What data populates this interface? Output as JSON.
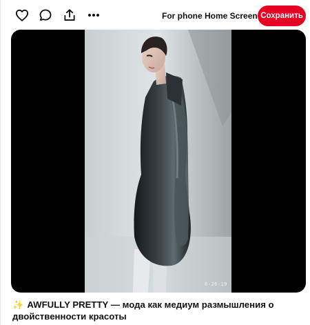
{
  "toolbar": {
    "icons": [
      "heart-icon",
      "comment-icon",
      "share-icon",
      "more-icon"
    ],
    "board_label": "For phone Home Screen",
    "save_label": "Сохранить",
    "save_color": "#e60023"
  },
  "media": {
    "stamp": "6-26-19"
  },
  "caption": {
    "emoji": "✨",
    "text": "AWFULLY PRETTY — мода как медиум размышления о двойственности красоты"
  }
}
